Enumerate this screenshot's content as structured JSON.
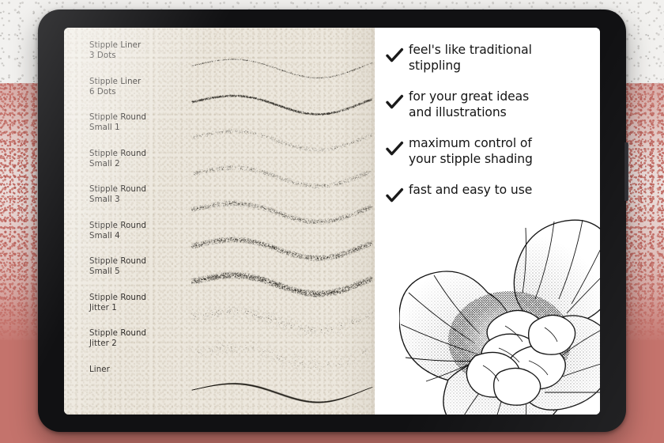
{
  "product": {
    "device": "tablet",
    "screen_title": "Stipple brush set preview"
  },
  "colors": {
    "background_rose": "#c4736c",
    "background_speckle_light": "#f2f1ef",
    "paper": "#ece7dd",
    "panel": "#ffffff",
    "ink": "#151515",
    "bezel": "#111113"
  },
  "brush_panel": {
    "brushes": [
      {
        "name": "Stipple Liner\n3 Dots",
        "style": "fine-dotted",
        "density": 0.32,
        "thickness": 1.5,
        "opacity": 0.72
      },
      {
        "name": "Stipple Liner\n6 Dots",
        "style": "dotted",
        "density": 0.6,
        "thickness": 2.6,
        "opacity": 0.88
      },
      {
        "name": "Stipple Round\nSmall 1",
        "style": "sparse-stipple",
        "density": 0.22,
        "thickness": 5.0,
        "opacity": 0.42
      },
      {
        "name": "Stipple Round\nSmall 2",
        "style": "sparse-stipple",
        "density": 0.3,
        "thickness": 6.0,
        "opacity": 0.5
      },
      {
        "name": "Stipple Round\nSmall 3",
        "style": "stipple",
        "density": 0.46,
        "thickness": 6.5,
        "opacity": 0.62
      },
      {
        "name": "Stipple Round\nSmall 4",
        "style": "stipple",
        "density": 0.62,
        "thickness": 7.0,
        "opacity": 0.74
      },
      {
        "name": "Stipple Round\nSmall 5",
        "style": "dense-stipple",
        "density": 0.82,
        "thickness": 8.0,
        "opacity": 0.86
      },
      {
        "name": "Stipple Round\nJitter 1",
        "style": "jitter",
        "density": 0.26,
        "thickness": 9.0,
        "opacity": 0.46
      },
      {
        "name": "Stipple Round\nJitter 2",
        "style": "jitter",
        "density": 0.2,
        "thickness": 12.0,
        "opacity": 0.38
      },
      {
        "name": "Liner",
        "style": "solid",
        "density": 1.0,
        "thickness": 3.2,
        "opacity": 1.0
      }
    ]
  },
  "features_panel": {
    "icon": "check-icon",
    "items": [
      "feel's like traditional\nstippling",
      "for your great ideas\nand illustrations",
      "maximum control of\nyour stipple shading",
      "fast and easy to use"
    ],
    "illustration": "stippled-flower-illustration"
  }
}
